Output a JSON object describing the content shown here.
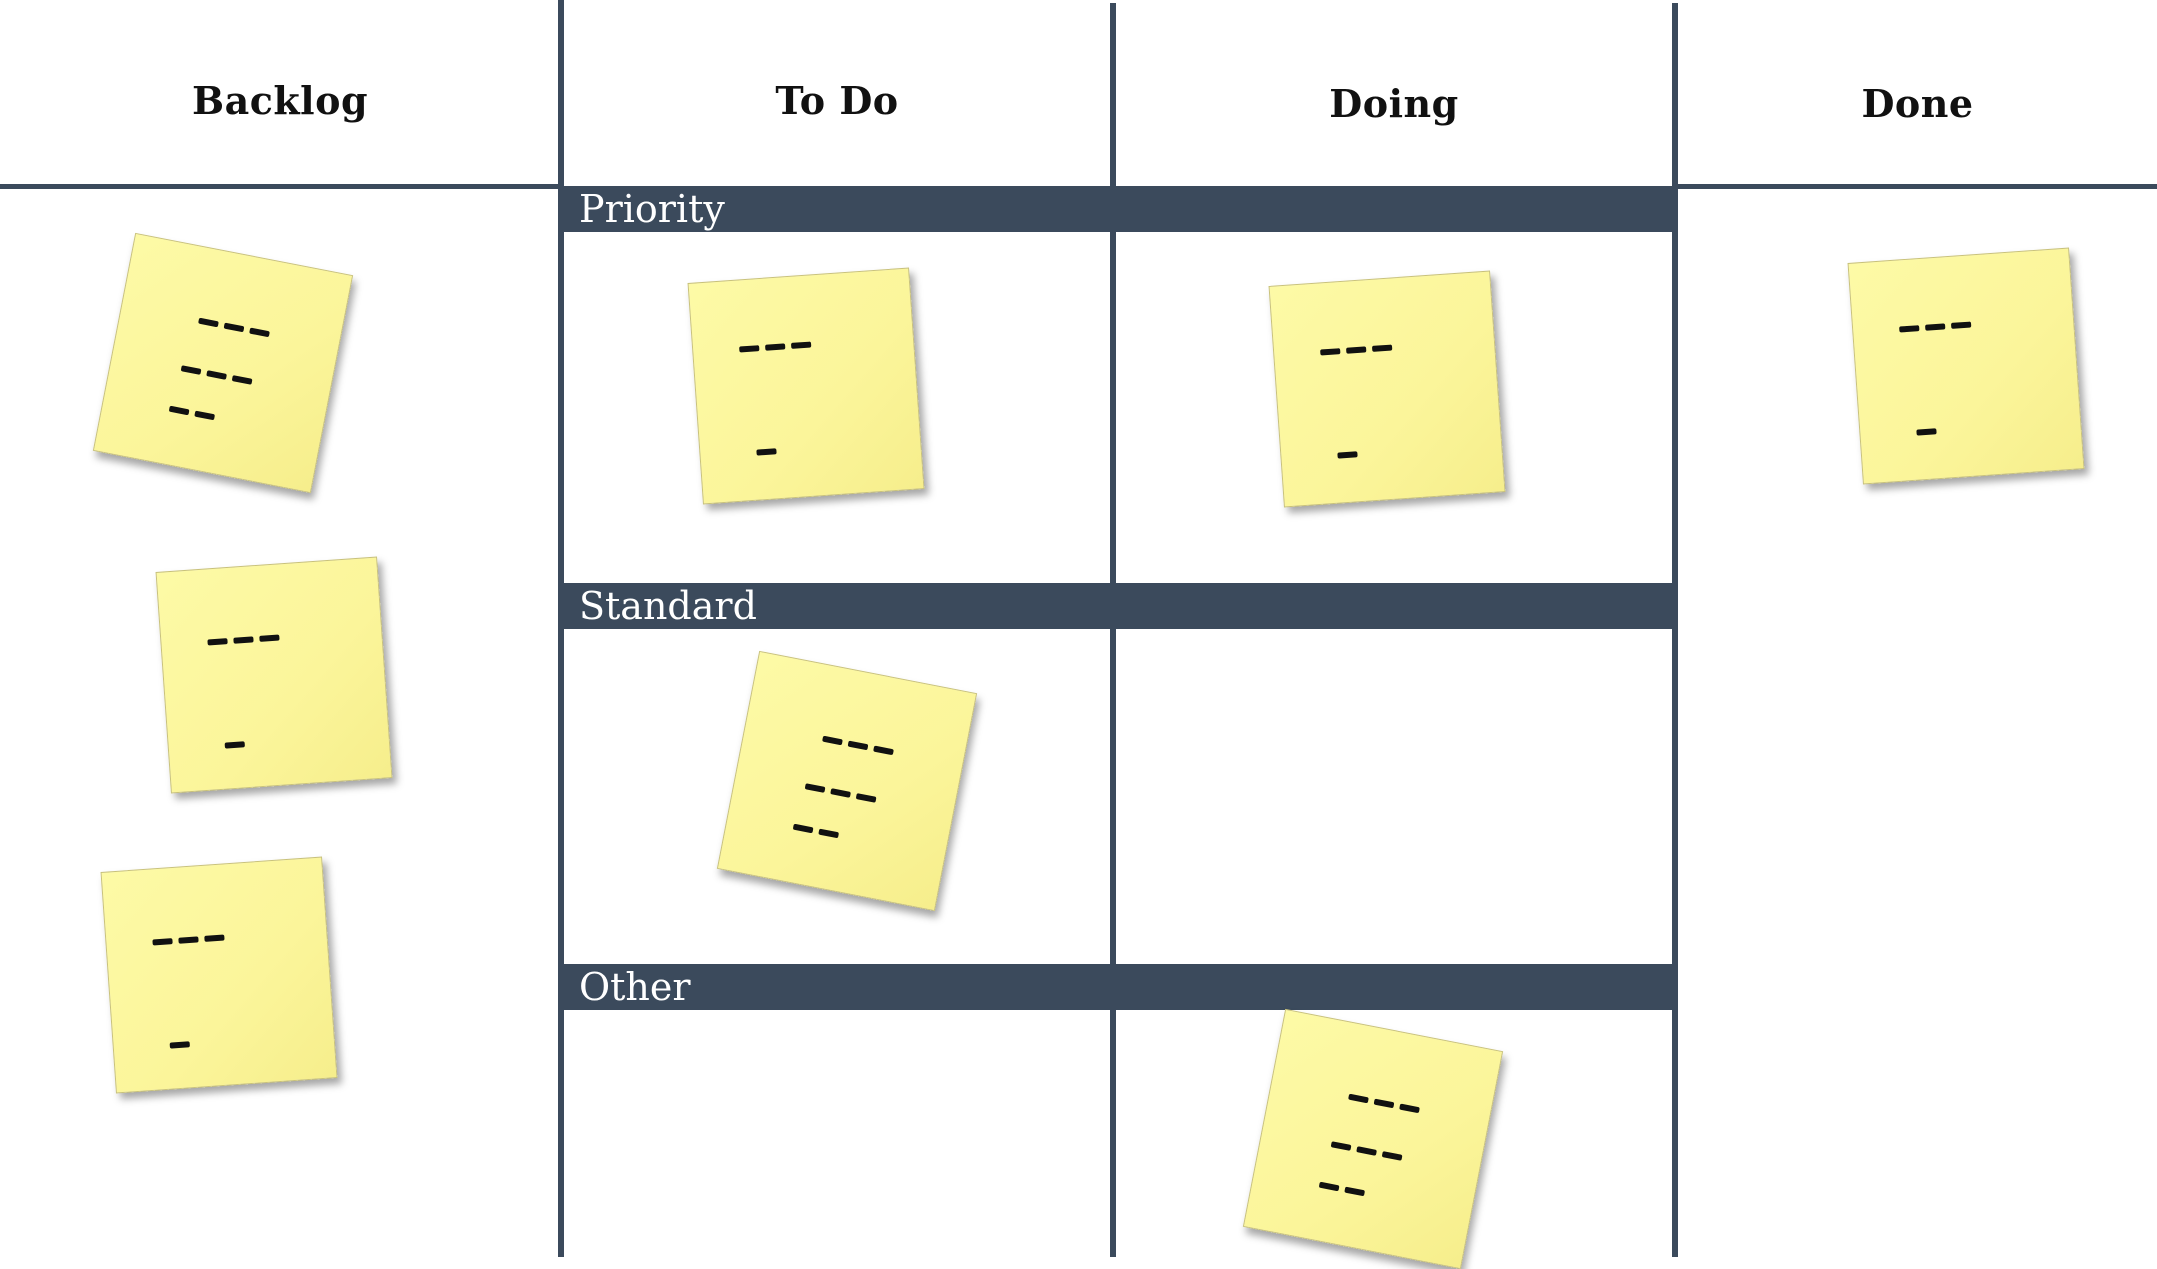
{
  "board": {
    "columns": [
      {
        "label": "Backlog"
      },
      {
        "label": "To Do"
      },
      {
        "label": "Doing"
      },
      {
        "label": "Done"
      }
    ],
    "lanes": [
      {
        "label": "Priority"
      },
      {
        "label": "Standard"
      },
      {
        "label": "Other"
      }
    ]
  },
  "colors": {
    "divider": "#3b4a5c",
    "note_fill": "#fbf59a",
    "lane_text": "#ffffff"
  }
}
